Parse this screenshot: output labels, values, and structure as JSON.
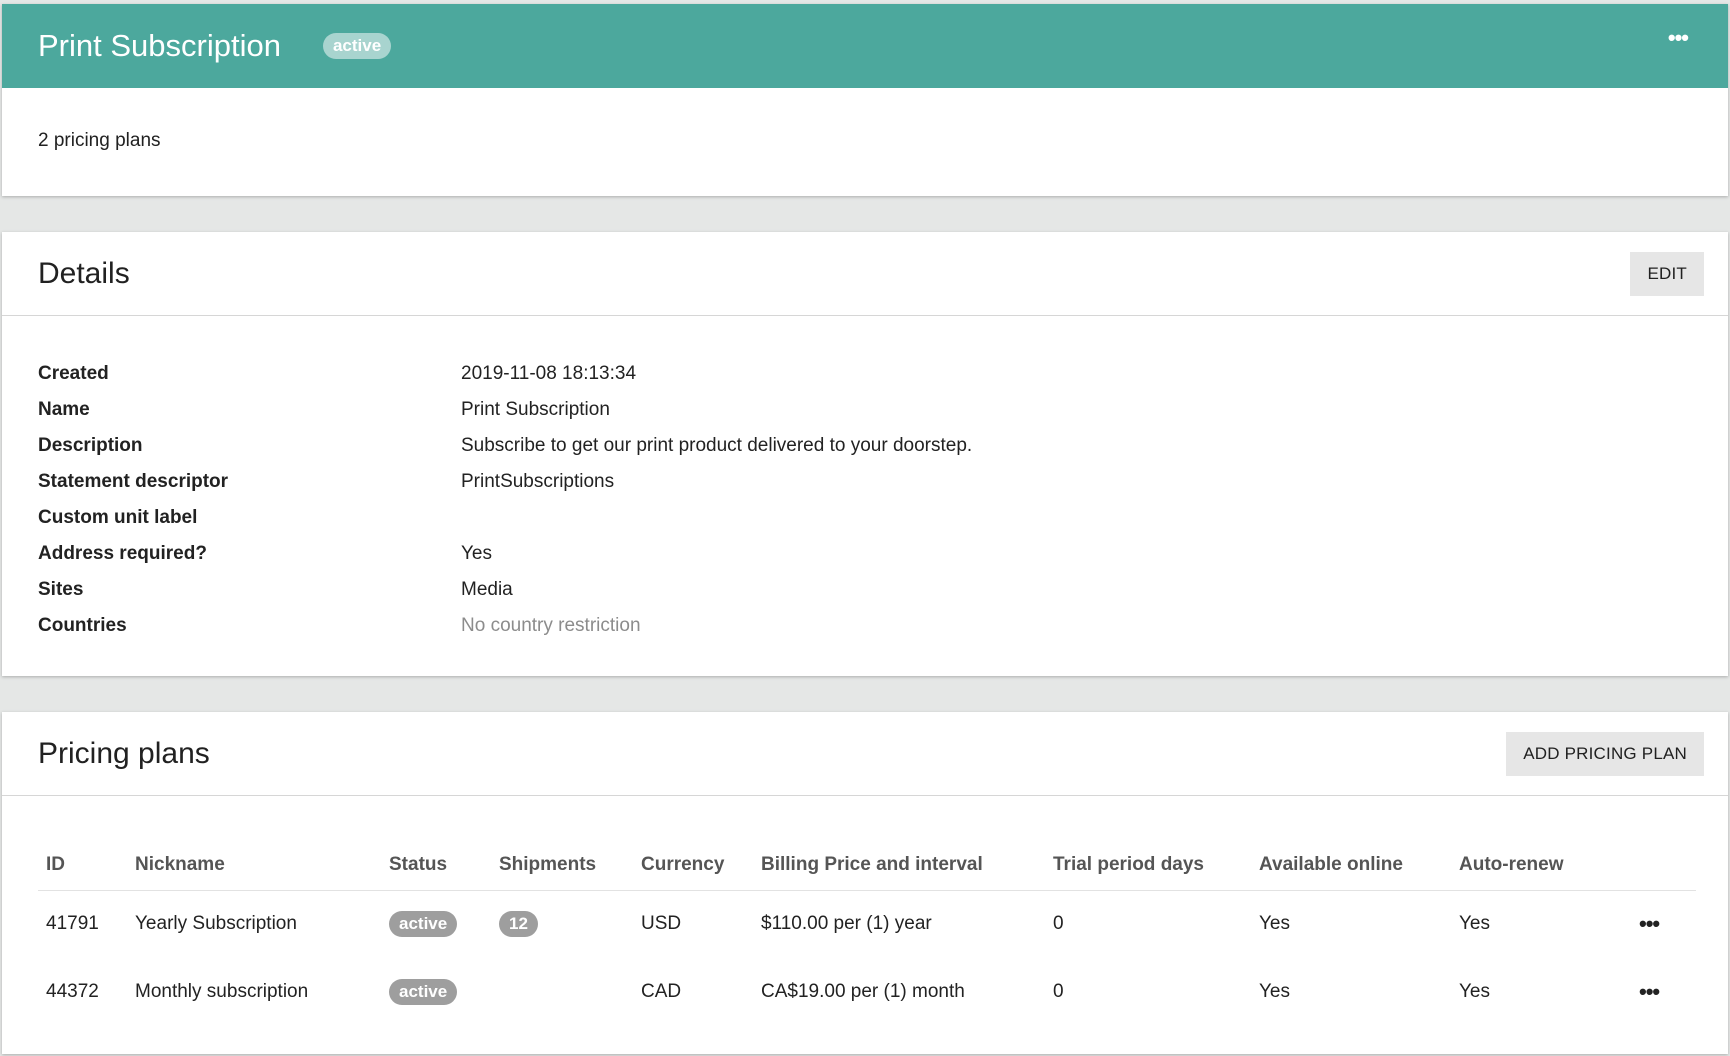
{
  "header": {
    "title": "Print Subscription",
    "status_badge": "active",
    "more_icon": "•••"
  },
  "summary": {
    "pricing_plans_count": "2 pricing plans"
  },
  "details": {
    "title": "Details",
    "edit_label": "EDIT",
    "rows": [
      {
        "label": "Created",
        "value": "2019-11-08 18:13:34"
      },
      {
        "label": "Name",
        "value": "Print Subscription"
      },
      {
        "label": "Description",
        "value": "Subscribe to get our print product delivered to your doorstep."
      },
      {
        "label": "Statement descriptor",
        "value": "PrintSubscriptions"
      },
      {
        "label": "Custom unit label",
        "value": ""
      },
      {
        "label": "Address required?",
        "value": "Yes"
      },
      {
        "label": "Sites",
        "value": "Media"
      },
      {
        "label": "Countries",
        "value": "No country restriction"
      }
    ]
  },
  "pricing_plans": {
    "title": "Pricing plans",
    "add_label": "ADD PRICING PLAN",
    "columns": [
      "ID",
      "Nickname",
      "Status",
      "Shipments",
      "Currency",
      "Billing Price and interval",
      "Trial period days",
      "Available online",
      "Auto-renew"
    ],
    "rows": [
      {
        "id": "41791",
        "nickname": "Yearly Subscription",
        "status": "active",
        "shipments": "12",
        "currency": "USD",
        "billing": "$110.00 per (1) year",
        "trial": "0",
        "online": "Yes",
        "autorenew": "Yes"
      },
      {
        "id": "44372",
        "nickname": "Monthly subscription",
        "status": "active",
        "shipments": "",
        "currency": "CAD",
        "billing": "CA$19.00 per (1) month",
        "trial": "0",
        "online": "Yes",
        "autorenew": "Yes"
      }
    ],
    "row_more_icon": "•••"
  },
  "colors": {
    "header_bg": "#4ca89d",
    "badge_bg": "#9e9e9e",
    "page_bg": "#e5e7e6"
  }
}
